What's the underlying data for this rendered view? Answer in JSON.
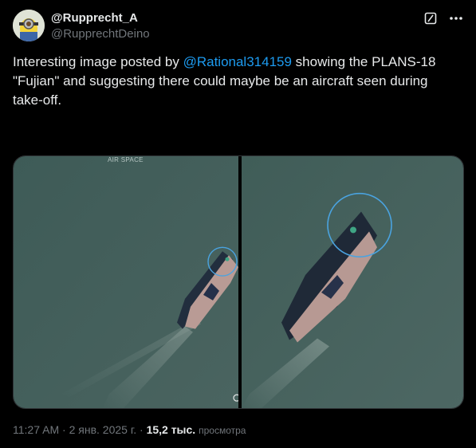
{
  "author": {
    "display_name": "@Rupprecht_A",
    "handle": "@RupprechtDeino"
  },
  "icons": {
    "grok": "grok-slash-icon",
    "more": "more-dots-icon"
  },
  "tweet": {
    "text_before": "Interesting image posted by ",
    "mention": "@Rational314159",
    "text_after": " showing the PLANS-18 \"Fujian\" and suggesting there could maybe be an aircraft seen during take-off."
  },
  "media": {
    "watermark": "AIR SPACE",
    "highlight_color": "#4aa3e0"
  },
  "meta": {
    "time": "11:27 AM",
    "separator": " · ",
    "date": "2 янв. 2025 г.",
    "views_count": "15,2 тыс.",
    "views_label": "просмотра"
  },
  "colors": {
    "background": "#000000",
    "text": "#e7e9ea",
    "muted": "#71767b",
    "link": "#1d9bf0"
  }
}
